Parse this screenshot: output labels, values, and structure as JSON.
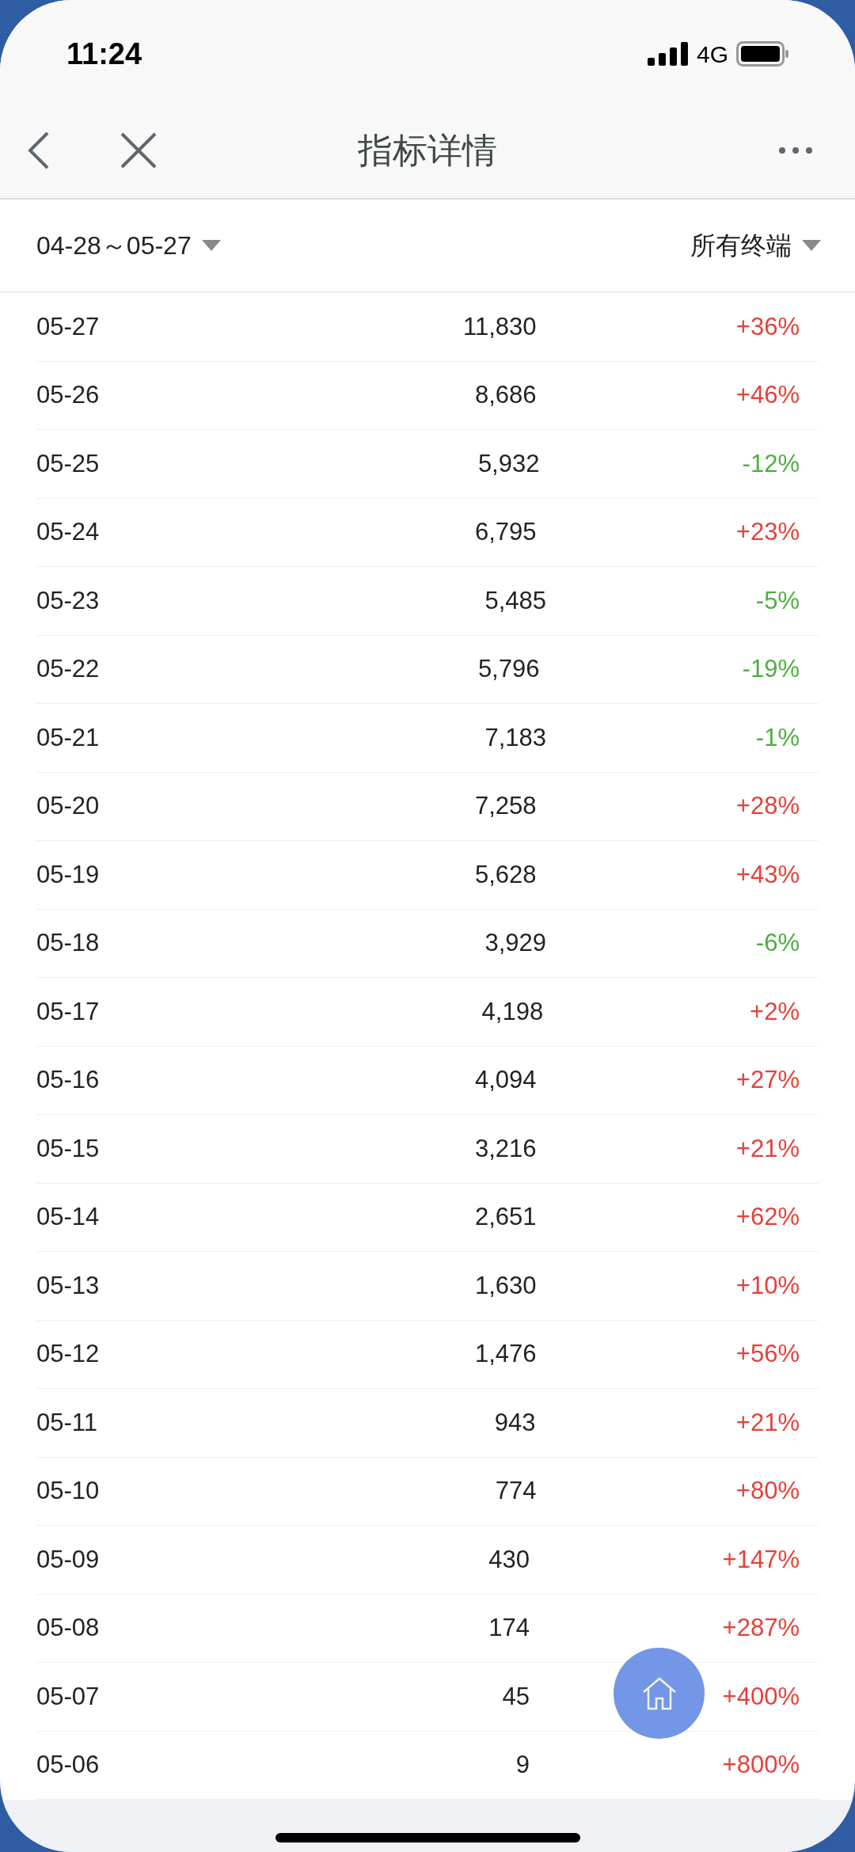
{
  "status_bar": {
    "time": "11:24",
    "network": "4G"
  },
  "nav": {
    "title": "指标详情"
  },
  "filters": {
    "date_range": "04-28～05-27",
    "terminal": "所有终端"
  },
  "rows": [
    {
      "date": "05-27",
      "value": "11,830",
      "change": "+36%",
      "kind": "up"
    },
    {
      "date": "05-26",
      "value": "8,686",
      "change": "+46%",
      "kind": "up"
    },
    {
      "date": "05-25",
      "value": "5,932",
      "change": "-12%",
      "kind": "down"
    },
    {
      "date": "05-24",
      "value": "6,795",
      "change": "+23%",
      "kind": "up"
    },
    {
      "date": "05-23",
      "value": "5,485",
      "change": "-5%",
      "kind": "down"
    },
    {
      "date": "05-22",
      "value": "5,796",
      "change": "-19%",
      "kind": "down"
    },
    {
      "date": "05-21",
      "value": "7,183",
      "change": "-1%",
      "kind": "down"
    },
    {
      "date": "05-20",
      "value": "7,258",
      "change": "+28%",
      "kind": "up"
    },
    {
      "date": "05-19",
      "value": "5,628",
      "change": "+43%",
      "kind": "up"
    },
    {
      "date": "05-18",
      "value": "3,929",
      "change": "-6%",
      "kind": "down"
    },
    {
      "date": "05-17",
      "value": "4,198",
      "change": "+2%",
      "kind": "up"
    },
    {
      "date": "05-16",
      "value": "4,094",
      "change": "+27%",
      "kind": "up"
    },
    {
      "date": "05-15",
      "value": "3,216",
      "change": "+21%",
      "kind": "up"
    },
    {
      "date": "05-14",
      "value": "2,651",
      "change": "+62%",
      "kind": "up"
    },
    {
      "date": "05-13",
      "value": "1,630",
      "change": "+10%",
      "kind": "up"
    },
    {
      "date": "05-12",
      "value": "1,476",
      "change": "+56%",
      "kind": "up"
    },
    {
      "date": "05-11",
      "value": "943",
      "change": "+21%",
      "kind": "up"
    },
    {
      "date": "05-10",
      "value": "774",
      "change": "+80%",
      "kind": "up"
    },
    {
      "date": "05-09",
      "value": "430",
      "change": "+147%",
      "kind": "up"
    },
    {
      "date": "05-08",
      "value": "174",
      "change": "+287%",
      "kind": "up"
    },
    {
      "date": "05-07",
      "value": "45",
      "change": "+400%",
      "kind": "up"
    },
    {
      "date": "05-06",
      "value": "9",
      "change": "+800%",
      "kind": "up"
    }
  ]
}
